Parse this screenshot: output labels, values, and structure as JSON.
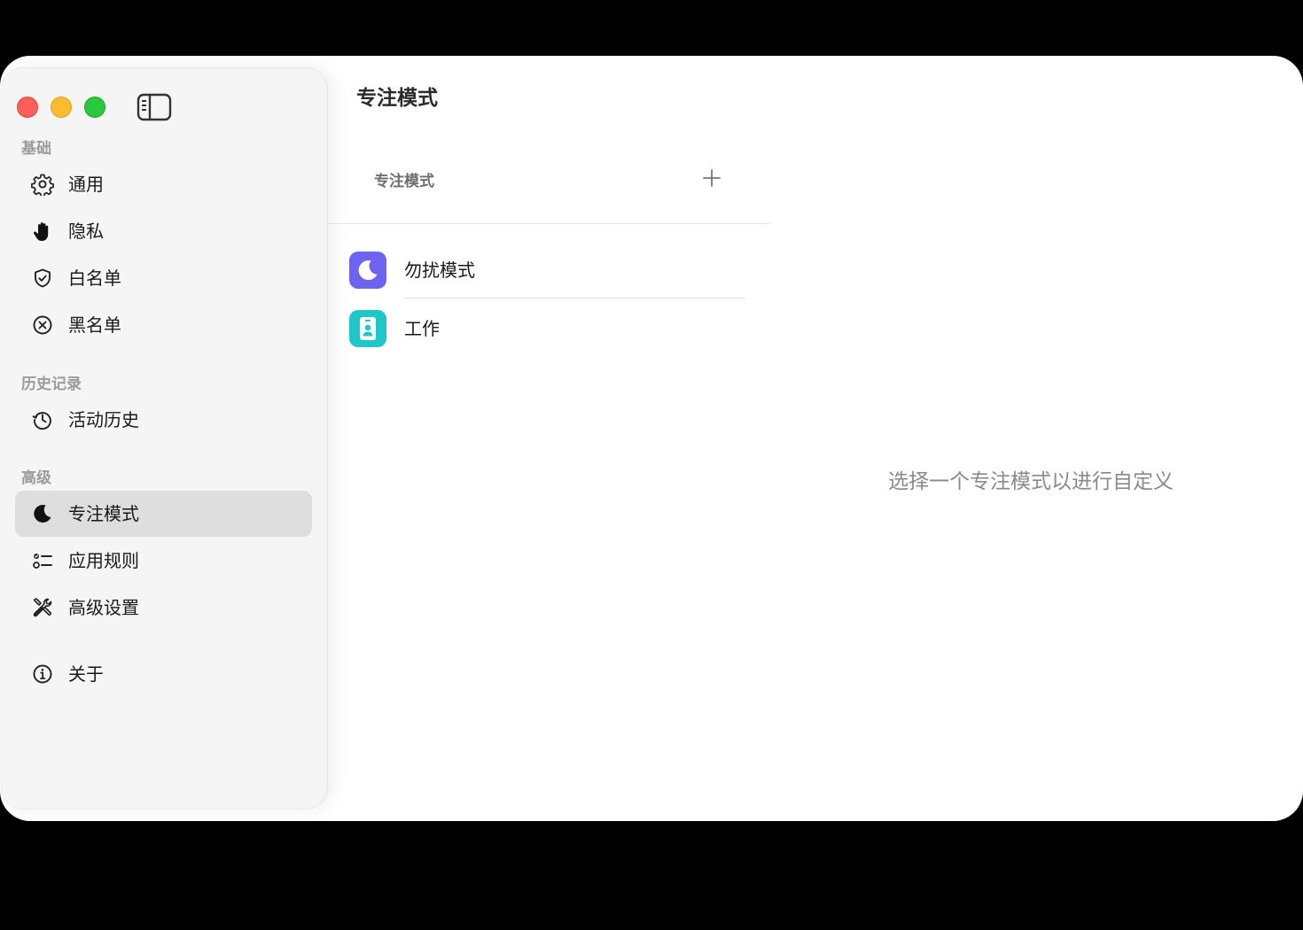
{
  "sidebar": {
    "sections": {
      "basic": "基础",
      "history": "历史记录",
      "advanced": "高级"
    },
    "items": {
      "general": "通用",
      "privacy": "隐私",
      "whitelist": "白名单",
      "blacklist": "黑名单",
      "activity_history": "活动历史",
      "focus_mode": "专注模式",
      "app_rules": "应用规则",
      "advanced_settings": "高级设置",
      "about": "关于"
    },
    "active_item": "专注模式"
  },
  "main": {
    "title": "专注模式",
    "list_header": "专注模式",
    "modes": [
      {
        "label": "勿扰模式",
        "icon": "moon-icon",
        "color": "#6e63f0"
      },
      {
        "label": "工作",
        "icon": "badge-icon",
        "color": "#1fc7c9"
      }
    ],
    "placeholder": "选择一个专注模式以进行自定义"
  },
  "colors": {
    "close": "#fe5f57",
    "minimize": "#febc2e",
    "maximize": "#28c840",
    "active_item_bg": "#dedede"
  }
}
